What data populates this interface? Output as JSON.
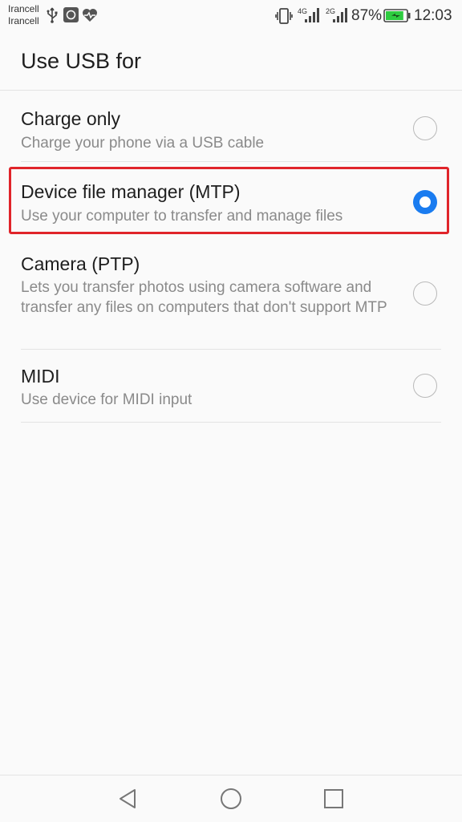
{
  "status_bar": {
    "carrier_1": "Irancell",
    "carrier_2": "Irancell",
    "network_1": "4G",
    "network_2": "2G",
    "battery_percent": "87%",
    "battery_level": 0.87,
    "time": "12:03",
    "icons": [
      "usb-icon",
      "app-notification-icon",
      "health-icon",
      "vibrate-icon",
      "signal-icon",
      "battery-charging-icon"
    ]
  },
  "header": {
    "title": "Use USB for"
  },
  "options": [
    {
      "title": "Charge only",
      "description": "Charge your phone via a USB cable",
      "selected": false
    },
    {
      "title": "Device file manager (MTP)",
      "description": "Use your computer to transfer and manage files",
      "selected": true
    },
    {
      "title": "Camera (PTP)",
      "description": "Lets you transfer photos using camera software and transfer any files on computers that don't support MTP",
      "selected": false
    },
    {
      "title": "MIDI",
      "description": "Use device for MIDI input",
      "selected": false
    }
  ],
  "colors": {
    "accent": "#1a7cf0",
    "highlight": "#e0242a",
    "battery": "#2ecc40"
  },
  "nav_bar": {
    "icons": [
      "back-icon",
      "home-icon",
      "recents-icon"
    ]
  }
}
